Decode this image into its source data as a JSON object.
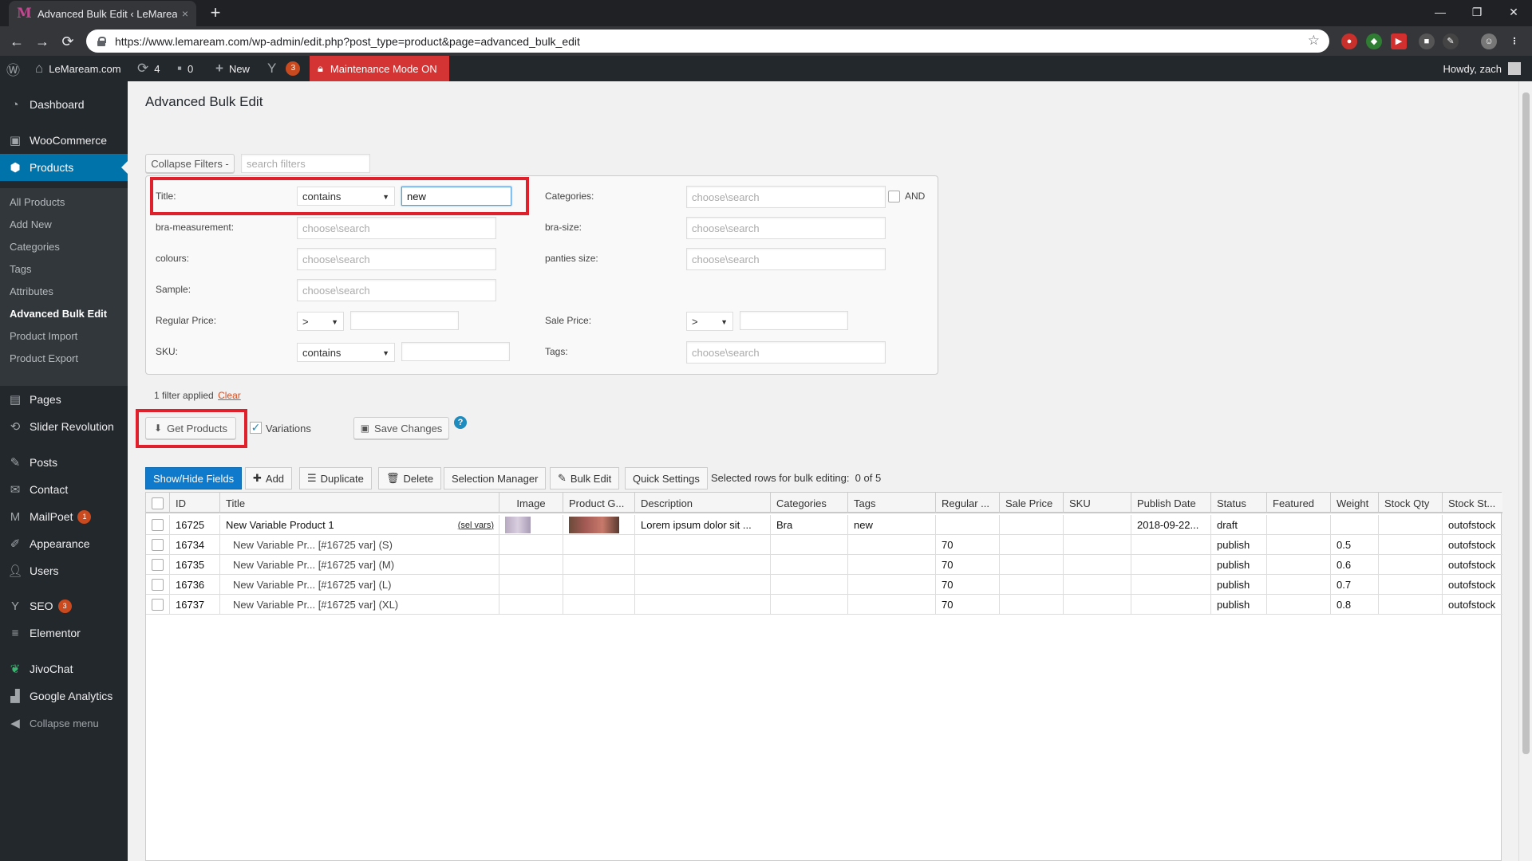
{
  "browser": {
    "tab_title": "Advanced Bulk Edit ‹ LeMaream.c",
    "tab_close": "×",
    "new_tab": "+",
    "url": "https://www.lemaream.com/wp-admin/edit.php?post_type=product&page=advanced_bulk_edit",
    "back": "←",
    "forward": "→",
    "reload": "⟳",
    "win_min": "—",
    "win_max": "❐",
    "win_close": "✕"
  },
  "adminbar": {
    "site_name": "LeMaream.com",
    "updates_count": "4",
    "comments_count": "0",
    "new_label": "New",
    "yoast_count": "3",
    "maintenance": "Maintenance Mode ON",
    "howdy": "Howdy, zach"
  },
  "sidebar": {
    "dashboard": "Dashboard",
    "woocommerce": "WooCommerce",
    "products": "Products",
    "sub": [
      "All Products",
      "Add New",
      "Categories",
      "Tags",
      "Attributes",
      "Advanced Bulk Edit",
      "Product Import",
      "Product Export"
    ],
    "pages": "Pages",
    "slider": "Slider Revolution",
    "posts": "Posts",
    "contact": "Contact",
    "mailpoet": "MailPoet",
    "mailpoet_badge": "1",
    "appearance": "Appearance",
    "users": "Users",
    "seo": "SEO",
    "seo_badge": "3",
    "elementor": "Elementor",
    "jivochat": "JivoChat",
    "ga": "Google Analytics",
    "collapse": "Collapse menu"
  },
  "page": {
    "title": "Advanced Bulk Edit",
    "collapse_filters": "Collapse Filters -",
    "search_filters_placeholder": "search filters"
  },
  "filters": {
    "title_label": "Title:",
    "title_op": "contains",
    "title_value": "new",
    "bra_measurement": "bra-measurement:",
    "colours": "colours:",
    "sample": "Sample:",
    "regular_price": "Regular Price:",
    "regular_op": ">",
    "sku": "SKU:",
    "sku_op": "contains",
    "categories": "Categories:",
    "and_label": "AND",
    "bra_size": "bra-size:",
    "panties_size": "panties size:",
    "sale_price": "Sale Price:",
    "sale_op": ">",
    "tags": "Tags:",
    "choose_placeholder": "choose\\search",
    "applied_text": "1 filter applied",
    "clear": "Clear"
  },
  "actions": {
    "get_products": "Get Products",
    "variations": "Variations",
    "save_changes": "Save Changes",
    "help": "?"
  },
  "grid_toolbar": {
    "show_hide": "Show/Hide Fields",
    "add": "Add",
    "duplicate": "Duplicate",
    "delete": "Delete",
    "selection_manager": "Selection Manager",
    "bulk_edit": "Bulk Edit",
    "quick_settings": "Quick Settings",
    "selected_info": "Selected rows for bulk editing:  0 of 5"
  },
  "table": {
    "columns": [
      "ID",
      "Title",
      "Image",
      "Product G...",
      "Description",
      "Categories",
      "Tags",
      "Regular ...",
      "Sale Price",
      "SKU",
      "Publish Date",
      "Status",
      "Featured",
      "Weight",
      "Stock Qty",
      "Stock St..."
    ],
    "sel_vars": "(sel vars)",
    "rows": [
      {
        "id": "16725",
        "title": "New Variable Product 1",
        "description": "Lorem ipsum dolor sit ...",
        "categories": "Bra",
        "tags": "new",
        "regular": "",
        "publish_date": "2018-09-22...",
        "status": "draft",
        "weight": "",
        "stock_status": "outofstock"
      },
      {
        "id": "16734",
        "title": "New Variable Pr... [#16725 var] (S)",
        "description": "",
        "categories": "",
        "tags": "",
        "regular": "70",
        "publish_date": "",
        "status": "publish",
        "weight": "0.5",
        "stock_status": "outofstock"
      },
      {
        "id": "16735",
        "title": "New Variable Pr... [#16725 var] (M)",
        "description": "",
        "categories": "",
        "tags": "",
        "regular": "70",
        "publish_date": "",
        "status": "publish",
        "weight": "0.6",
        "stock_status": "outofstock"
      },
      {
        "id": "16736",
        "title": "New Variable Pr... [#16725 var] (L)",
        "description": "",
        "categories": "",
        "tags": "",
        "regular": "70",
        "publish_date": "",
        "status": "publish",
        "weight": "0.7",
        "stock_status": "outofstock"
      },
      {
        "id": "16737",
        "title": "New Variable Pr... [#16725 var] (XL)",
        "description": "",
        "categories": "",
        "tags": "",
        "regular": "70",
        "publish_date": "",
        "status": "publish",
        "weight": "0.8",
        "stock_status": "outofstock"
      }
    ]
  },
  "colors": {
    "wp_dark": "#23282d",
    "wp_blue": "#0073aa",
    "highlight_red": "#e0202a",
    "maintenance_red": "#d43434"
  }
}
